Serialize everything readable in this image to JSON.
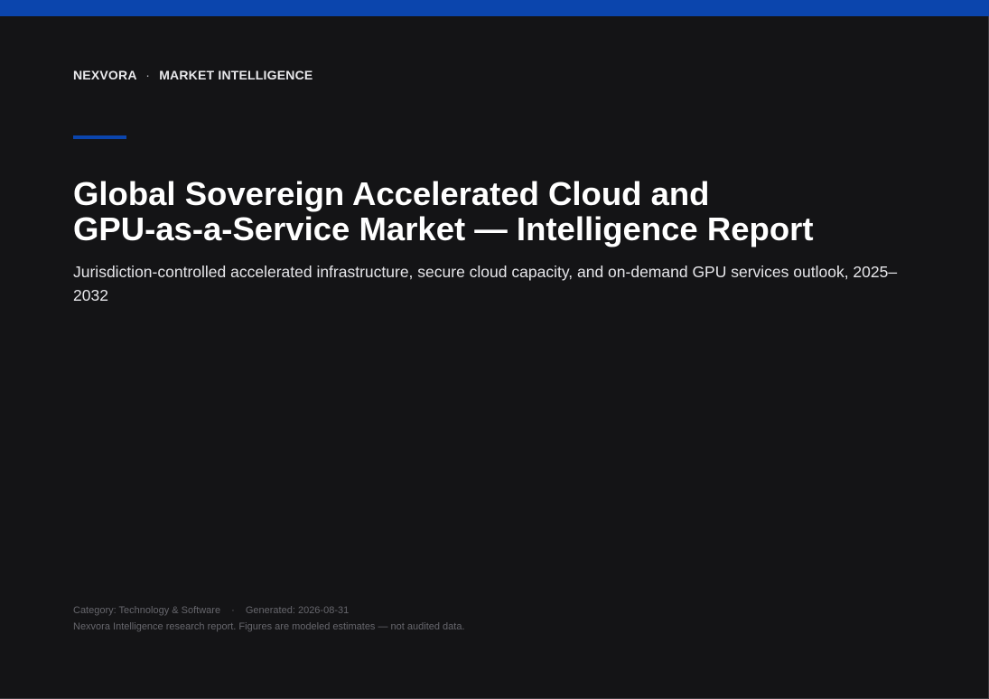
{
  "header": {
    "brand": "NEXVORA",
    "separator": "·",
    "section": "MARKET INTELLIGENCE"
  },
  "report": {
    "title_line1": "Global Sovereign Accelerated Cloud and",
    "title_line2": "GPU-as-a-Service Market — Intelligence Report",
    "subtitle": "Jurisdiction-controlled accelerated infrastructure, secure cloud capacity, and on-demand GPU services outlook, 2025–2032"
  },
  "footer": {
    "category": "Category: Technology & Software",
    "separator": "·",
    "generated": "Generated: 2026-08-31",
    "disclaimer": "Nexvora Intelligence research report. Figures are modeled estimates — not audited data."
  },
  "colors": {
    "background": "#141416",
    "accent": "#0b45ad",
    "title": "#ffffff",
    "muted": "#66666c"
  }
}
